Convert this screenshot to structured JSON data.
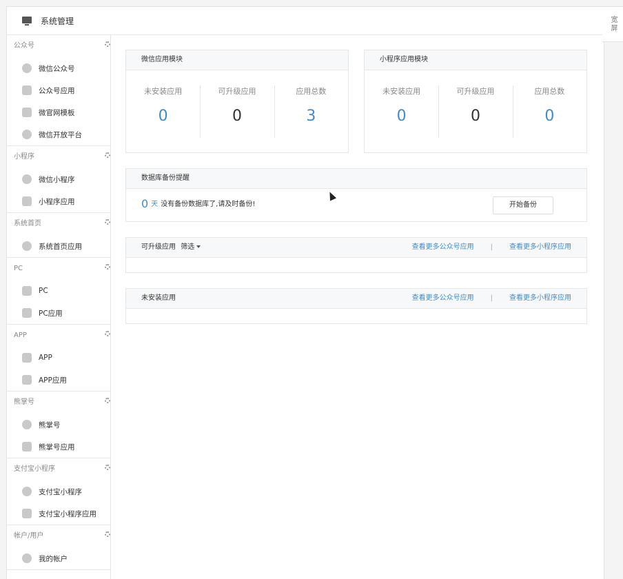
{
  "header": {
    "title": "系统管理",
    "wide_toggle": "宽屏"
  },
  "sidebar": {
    "groups": [
      {
        "title": "公众号",
        "items": [
          {
            "label": "微信公众号",
            "icon": "wechat-icon"
          },
          {
            "label": "公众号应用",
            "icon": "bag-icon"
          },
          {
            "label": "微官网模板",
            "icon": "template-icon"
          },
          {
            "label": "微信开放平台",
            "icon": "open-platform-icon"
          }
        ]
      },
      {
        "title": "小程序",
        "items": [
          {
            "label": "微信小程序",
            "icon": "miniprogram-icon"
          },
          {
            "label": "小程序应用",
            "icon": "bag-icon"
          }
        ]
      },
      {
        "title": "系统首页",
        "items": [
          {
            "label": "系统首页应用",
            "icon": "miniprogram-icon"
          }
        ]
      },
      {
        "title": "PC",
        "items": [
          {
            "label": "PC",
            "icon": "pc-icon"
          },
          {
            "label": "PC应用",
            "icon": "bag-icon"
          }
        ]
      },
      {
        "title": "APP",
        "items": [
          {
            "label": "APP",
            "icon": "phone-icon"
          },
          {
            "label": "APP应用",
            "icon": "bag-icon"
          }
        ]
      },
      {
        "title": "熊掌号",
        "items": [
          {
            "label": "熊掌号",
            "icon": "paw-icon"
          },
          {
            "label": "熊掌号应用",
            "icon": "bag-icon"
          }
        ]
      },
      {
        "title": "支付宝小程序",
        "items": [
          {
            "label": "支付宝小程序",
            "icon": "alipay-icon"
          },
          {
            "label": "支付宝小程序应用",
            "icon": "bag-icon"
          }
        ]
      },
      {
        "title": "帐户/用户",
        "items": [
          {
            "label": "我的帐户",
            "icon": "user-icon"
          }
        ]
      }
    ]
  },
  "wechat_module": {
    "title": "微信应用模块",
    "stats": [
      {
        "label": "未安装应用",
        "value": "0"
      },
      {
        "label": "可升级应用",
        "value": "0"
      },
      {
        "label": "应用总数",
        "value": "3"
      }
    ]
  },
  "miniprogram_module": {
    "title": "小程序应用模块",
    "stats": [
      {
        "label": "未安装应用",
        "value": "0"
      },
      {
        "label": "可升级应用",
        "value": "0"
      },
      {
        "label": "应用总数",
        "value": "0"
      }
    ]
  },
  "backup": {
    "title": "数据库备份提醒",
    "days": "0",
    "unit": "天",
    "message": "没有备份数据库了,请及时备份!",
    "button": "开始备份"
  },
  "upgradable": {
    "title": "可升级应用",
    "filter": "筛选",
    "link_official": "查看更多公众号应用",
    "separator": "|",
    "link_mini": "查看更多小程序应用"
  },
  "uninstalled": {
    "title": "未安装应用",
    "link_official": "查看更多公众号应用",
    "separator": "|",
    "link_mini": "查看更多小程序应用"
  },
  "colors": {
    "accent": "#428bca"
  }
}
